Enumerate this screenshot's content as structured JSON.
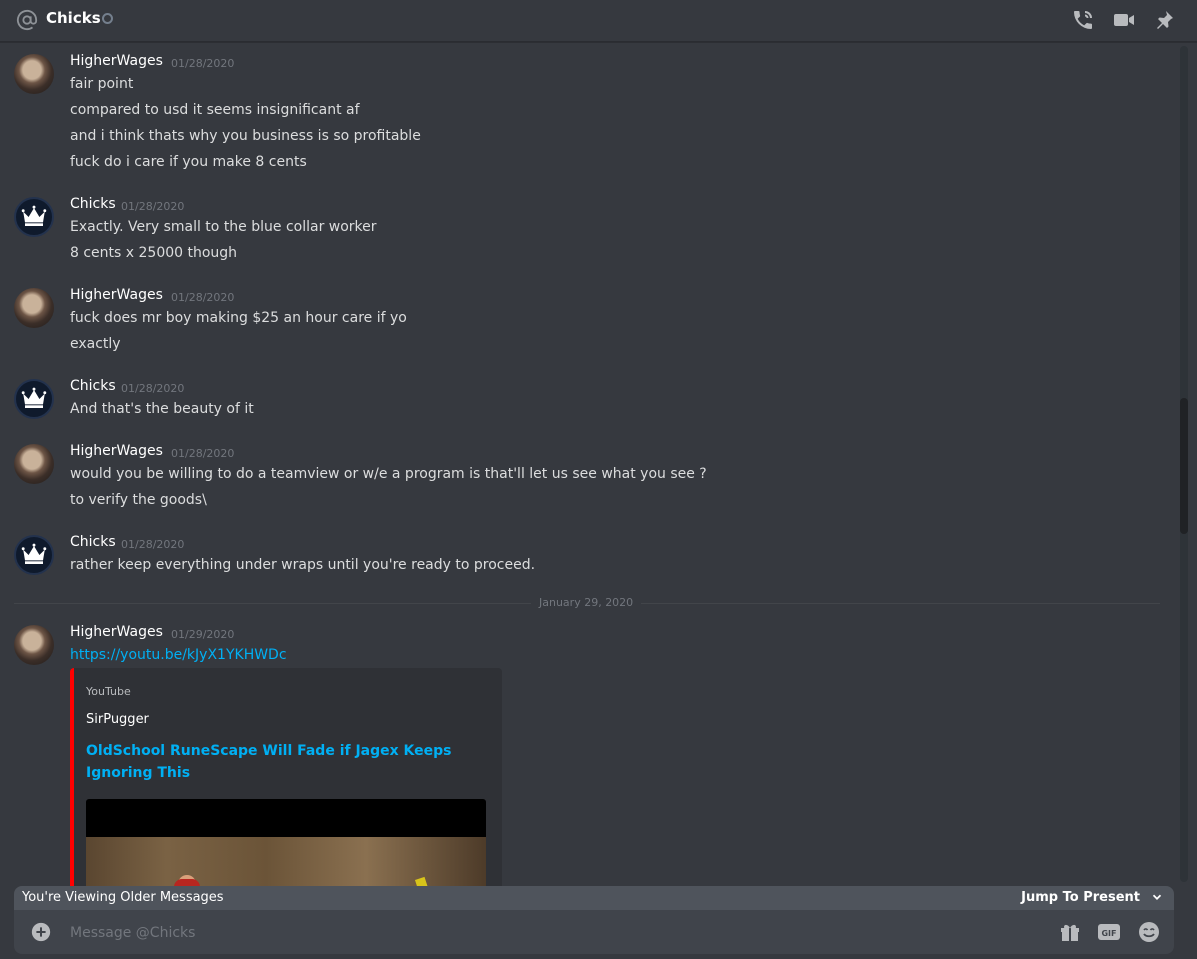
{
  "header": {
    "channel_name": "Chicks",
    "icons": [
      "at-icon",
      "status-icon",
      "phone-call-icon",
      "video-call-icon",
      "pin-icon"
    ]
  },
  "messages": [
    {
      "author": "HigherWages",
      "timestamp": "01/28/2020",
      "avatar": "higherwages-avatar",
      "lines": [
        "fair point",
        "compared to usd it seems insignificant af",
        "and i think thats why you business is so profitable",
        "fuck do i care if you make 8 cents"
      ]
    },
    {
      "author": "Chicks",
      "timestamp": "01/28/2020",
      "avatar": "chicks-crown-avatar",
      "lines": [
        "Exactly. Very small to the blue collar worker",
        "8 cents x 25000 though"
      ]
    },
    {
      "author": "HigherWages",
      "timestamp": "01/28/2020",
      "avatar": "higherwages-avatar",
      "lines": [
        "fuck does mr  boy making $25 an hour care if yo",
        "exactly"
      ]
    },
    {
      "author": "Chicks",
      "timestamp": "01/28/2020",
      "avatar": "chicks-crown-avatar",
      "lines": [
        "And that's the beauty of it"
      ]
    },
    {
      "author": "HigherWages",
      "timestamp": "01/28/2020",
      "avatar": "higherwages-avatar",
      "lines": [
        "would you be willing to do a teamview or w/e a program is that'll let us see what you see ?",
        "to verify the goods\\"
      ]
    },
    {
      "author": "Chicks",
      "timestamp": "01/28/2020",
      "avatar": "chicks-crown-avatar",
      "lines": [
        "rather keep everything under wraps until you're ready to proceed."
      ]
    },
    {
      "author": "HigherWages",
      "timestamp": "01/29/2020",
      "avatar": "higherwages-avatar",
      "link": "https://youtu.be/kJyX1YKHWDc"
    }
  ],
  "date_divider": "January 29, 2020",
  "embed": {
    "provider": "YouTube",
    "author": "SirPugger",
    "title": "OldSchool RuneScape Will Fade if Jagex Keeps Ignoring This",
    "accent_color": "#ff0000"
  },
  "older_bar": {
    "text": "You're Viewing Older Messages",
    "jump_label": "Jump To Present"
  },
  "composer": {
    "placeholder": "Message @Chicks",
    "icons": [
      "add-attachment-icon",
      "gift-icon",
      "gif-icon",
      "emoji-icon"
    ]
  },
  "colors": {
    "background": "#36393f",
    "link": "#00b0f4",
    "muted": "#72767d"
  }
}
